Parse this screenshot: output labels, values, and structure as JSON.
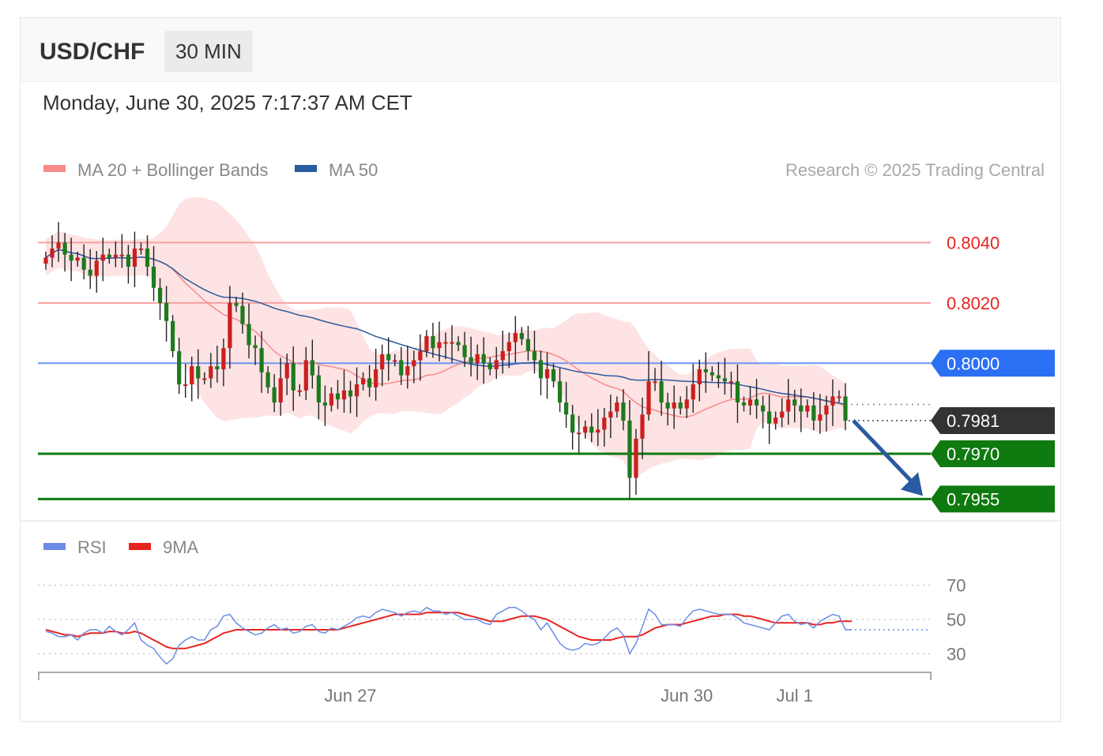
{
  "header": {
    "pair": "USD/CHF",
    "timeframe": "30 MIN",
    "datetime": "Monday, June 30, 2025 7:17:37 AM CET"
  },
  "legend": {
    "ma20": "MA 20 + Bollinger Bands",
    "ma50": "MA 50",
    "copyright": "Research © 2025 Trading Central",
    "rsi": "RSI",
    "rsi_ma": "9MA"
  },
  "colors": {
    "ma20": "#f88a8a",
    "band_fill": "#fde3e3",
    "ma50": "#2a5aa0",
    "resistance": "#f6a0a0",
    "resistance_text": "#e8231f",
    "pivot": "#2b6ff2",
    "support": "#0f7a0f",
    "current": "#333333",
    "bull": "#cc1f1f",
    "bear": "#1e7a1e",
    "rsi": "#6b8ce8",
    "rsi_ma": "#e8231f",
    "arrow": "#2a5aa0"
  },
  "chart_data": {
    "type": "candlestick",
    "interval": "30 MIN",
    "ylim": [
      0.7953,
      0.8055
    ],
    "levels": [
      {
        "label": "0.8040",
        "value": 0.804,
        "kind": "resistance"
      },
      {
        "label": "0.8020",
        "value": 0.802,
        "kind": "resistance"
      },
      {
        "label": "0.8000",
        "value": 0.8,
        "kind": "pivot"
      },
      {
        "label": "0.7981",
        "value": 0.7981,
        "kind": "current"
      },
      {
        "label": "0.7970",
        "value": 0.797,
        "kind": "support"
      },
      {
        "label": "0.7955",
        "value": 0.7955,
        "kind": "support"
      }
    ],
    "x_ticks": [
      {
        "label": "Jun 27",
        "index": 48
      },
      {
        "label": "Jun 30",
        "index": 101
      },
      {
        "label": "Jul 1",
        "index": 118
      }
    ],
    "close": [
      0.8035,
      0.8038,
      0.804,
      0.8036,
      0.8034,
      0.8035,
      0.8031,
      0.8029,
      0.8034,
      0.8036,
      0.8035,
      0.8036,
      0.8036,
      0.8032,
      0.8038,
      0.8038,
      0.8032,
      0.8025,
      0.802,
      0.8014,
      0.8004,
      0.7993,
      0.7993,
      0.7999,
      0.7995,
      0.7995,
      0.7999,
      0.7998,
      0.8005,
      0.802,
      0.8019,
      0.8013,
      0.8006,
      0.8005,
      0.7997,
      0.7992,
      0.7987,
      0.7995,
      0.8,
      0.7991,
      0.7991,
      0.8001,
      0.7996,
      0.7987,
      0.7986,
      0.799,
      0.7988,
      0.7991,
      0.7989,
      0.7993,
      0.7995,
      0.7992,
      0.7998,
      0.8003,
      0.8001,
      0.8001,
      0.7996,
      0.7999,
      0.8001,
      0.8004,
      0.8009,
      0.8005,
      0.8007,
      0.8007,
      0.8007,
      0.8006,
      0.8002,
      0.8,
      0.8003,
      0.8,
      0.7998,
      0.8001,
      0.8004,
      0.8007,
      0.801,
      0.8008,
      0.8004,
      0.8001,
      0.7995,
      0.7998,
      0.7994,
      0.7987,
      0.7983,
      0.7977,
      0.7977,
      0.7979,
      0.7977,
      0.7978,
      0.7982,
      0.7984,
      0.7987,
      0.7981,
      0.7962,
      0.7975,
      0.7983,
      0.7994,
      0.7994,
      0.7987,
      0.7985,
      0.7987,
      0.7985,
      0.7988,
      0.7993,
      0.7998,
      0.7997,
      0.7996,
      0.7995,
      0.7994,
      0.7994,
      0.7987,
      0.7986,
      0.7988,
      0.7986,
      0.7984,
      0.798,
      0.7982,
      0.7984,
      0.7988,
      0.7986,
      0.7984,
      0.7986,
      0.7981,
      0.7983,
      0.7986,
      0.7989,
      0.7989,
      0.7981
    ],
    "rsi": [
      43,
      42,
      40,
      40,
      41,
      38,
      42,
      44,
      44,
      42,
      46,
      43,
      41,
      44,
      48,
      38,
      35,
      33,
      28,
      24,
      27,
      35,
      38,
      40,
      38,
      38,
      44,
      46,
      52,
      53,
      48,
      45,
      43,
      41,
      42,
      45,
      47,
      44,
      45,
      42,
      43,
      46,
      47,
      43,
      42,
      45,
      44,
      46,
      48,
      51,
      52,
      51,
      54,
      56,
      55,
      54,
      52,
      54,
      55,
      54,
      57,
      55,
      55,
      53,
      54,
      52,
      50,
      50,
      50,
      48,
      47,
      53,
      55,
      57,
      57,
      55,
      52,
      50,
      44,
      48,
      42,
      36,
      33,
      32,
      33,
      36,
      35,
      36,
      39,
      43,
      45,
      41,
      30,
      36,
      46,
      56,
      53,
      47,
      47,
      47,
      46,
      51,
      55,
      56,
      55,
      54,
      53,
      53,
      53,
      51,
      48,
      47,
      46,
      45,
      44,
      48,
      52,
      53,
      49,
      47,
      48,
      45,
      49,
      51,
      53,
      52,
      44,
      44
    ],
    "rsi_ma": [
      44,
      43,
      42,
      41,
      41,
      40,
      41,
      42,
      42,
      42,
      43,
      43,
      42,
      42,
      43,
      42,
      40,
      38,
      36,
      34,
      33,
      33,
      33,
      34,
      35,
      36,
      38,
      40,
      42,
      43,
      44,
      44,
      44,
      44,
      44,
      44,
      44,
      44,
      44,
      44,
      44,
      44,
      44,
      44,
      44,
      44,
      44,
      45,
      46,
      47,
      48,
      49,
      50,
      51,
      52,
      53,
      53,
      53,
      53,
      53,
      54,
      54,
      54,
      54,
      54,
      54,
      53,
      52,
      51,
      50,
      49,
      49,
      49,
      50,
      51,
      52,
      52,
      52,
      51,
      50,
      48,
      46,
      44,
      42,
      40,
      39,
      38,
      38,
      38,
      38,
      39,
      40,
      40,
      40,
      41,
      43,
      45,
      46,
      47,
      47,
      47,
      48,
      49,
      50,
      51,
      52,
      52,
      53,
      53,
      53,
      52,
      52,
      51,
      50,
      49,
      48,
      48,
      48,
      48,
      48,
      48,
      47,
      47,
      48,
      48,
      49,
      49,
      49
    ],
    "rsi_levels": [
      70,
      50,
      30
    ],
    "rsi_ylim": [
      20,
      80
    ]
  }
}
